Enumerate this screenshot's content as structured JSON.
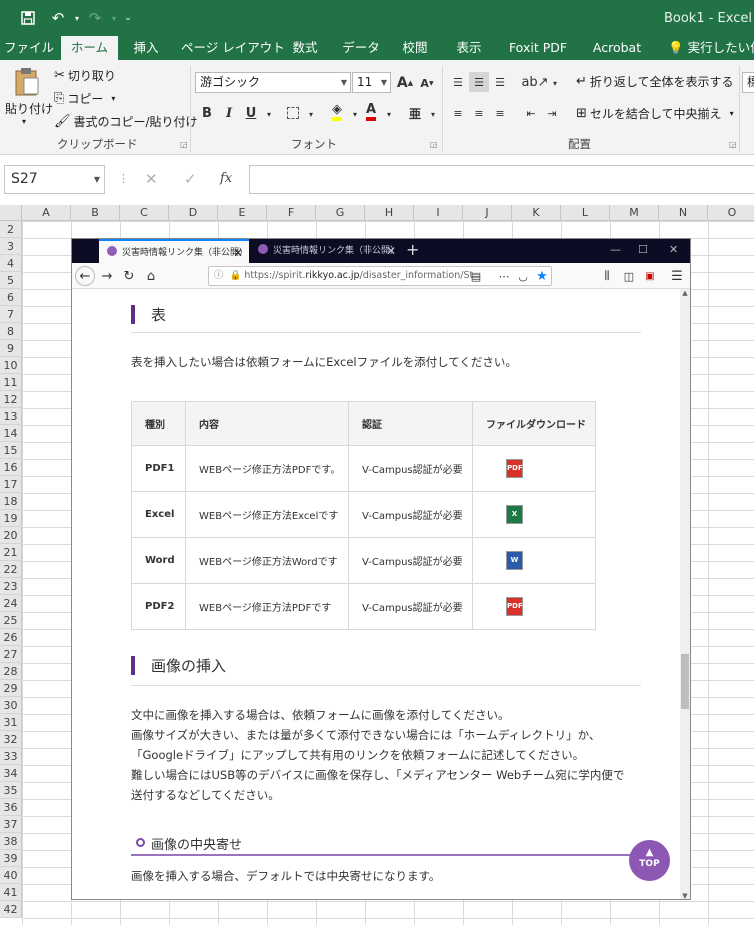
{
  "app": {
    "window_title": "Book1 - Excel",
    "qat": {
      "save_icon": "save-icon",
      "undo_icon": "undo-icon",
      "redo_icon": "redo-icon",
      "customize_icon": "chevron-down-icon"
    }
  },
  "ribbon_tabs": [
    {
      "label": "ファイル"
    },
    {
      "label": "ホーム"
    },
    {
      "label": "挿入"
    },
    {
      "label": "ページ レイアウト"
    },
    {
      "label": "数式"
    },
    {
      "label": "データ"
    },
    {
      "label": "校閲"
    },
    {
      "label": "表示"
    },
    {
      "label": "Foxit PDF"
    },
    {
      "label": "Acrobat"
    },
    {
      "label": "実行したい作業"
    }
  ],
  "clipboard": {
    "paste": "貼り付け",
    "cut": "切り取り",
    "copy": "コピー",
    "format_painter": "書式のコピー/貼り付け",
    "group_label": "クリップボード"
  },
  "font": {
    "name": "游ゴシック",
    "size": "11",
    "group_label": "フォント",
    "bold": "B",
    "italic": "I",
    "underline": "U",
    "font_color_glyph": "A",
    "grow_glyph": "A",
    "shrink_glyph": "A",
    "phonetic_glyph": "亜"
  },
  "alignment": {
    "wrap_text": "折り返して全体を表示する",
    "merge_center": "セルを結合して中央揃え",
    "group_label": "配置",
    "number_format_glyph": "標"
  },
  "formula_bar": {
    "name_box": "S27",
    "cancel_glyph": "✕",
    "enter_glyph": "✓",
    "fx_glyph": "fx",
    "value": ""
  },
  "sheet": {
    "columns": [
      "A",
      "B",
      "C",
      "D",
      "E",
      "F",
      "G",
      "H",
      "I",
      "J",
      "K",
      "L",
      "M",
      "N",
      "O"
    ],
    "rows": [
      "2",
      "3",
      "4",
      "5",
      "6",
      "7",
      "8",
      "9",
      "10",
      "11",
      "12",
      "13",
      "14",
      "15",
      "16",
      "17",
      "18",
      "19",
      "20",
      "21",
      "22",
      "23",
      "24",
      "25",
      "26",
      "27",
      "28",
      "29",
      "30",
      "31",
      "32",
      "33",
      "34",
      "35",
      "36",
      "37",
      "38",
      "39",
      "40",
      "41",
      "42"
    ]
  },
  "browser": {
    "tabs": [
      {
        "label": "災害時情報リンク集（非公開）"
      },
      {
        "label": "災害時情報リンク集（非公開）"
      }
    ],
    "url_prefix": "https://spirit.",
    "url_domain": "rikkyo.ac.jp",
    "url_path": "/disaster_information/St",
    "page": {
      "table_heading": "表",
      "table_intro": "表を挿入したい場合は依頼フォームにExcelファイルを添付してください。",
      "table": {
        "headers": [
          "種別",
          "内容",
          "認証",
          "ファイルダウンロード"
        ],
        "rows": [
          {
            "type": "PDF1",
            "content": "WEBページ修正方法PDFです。",
            "auth": "V-Campus認証が必要",
            "icon": "pdf-file-icon",
            "icon_label": "PDF",
            "icon_color": "#d9322b"
          },
          {
            "type": "Excel",
            "content": "WEBページ修正方法Excelです",
            "auth": "V-Campus認証が必要",
            "icon": "excel-file-icon",
            "icon_label": "X",
            "icon_color": "#1d7a46"
          },
          {
            "type": "Word",
            "content": "WEBページ修正方法Wordです",
            "auth": "V-Campus認証が必要",
            "icon": "word-file-icon",
            "icon_label": "W",
            "icon_color": "#2b5aa8"
          },
          {
            "type": "PDF2",
            "content": "WEBページ修正方法PDFです",
            "auth": "V-Campus認証が必要",
            "icon": "pdf-file-icon",
            "icon_label": "PDF",
            "icon_color": "#d9322b"
          }
        ]
      },
      "image_heading": "画像の挿入",
      "image_paragraph": [
        "文中に画像を挿入する場合は、依頼フォームに画像を添付してください。",
        "画像サイズが大きい、または量が多くて添付できない場合には「ホームディレクトリ」か、",
        "「Googleドライブ」にアップして共有用のリンクを依頼フォームに記述してください。",
        "難しい場合にはUSB等のデバイスに画像を保存し、「メディアセンター Webチーム宛に学内便で",
        "送付するなどしてください。"
      ],
      "center_heading": "画像の中央寄せ",
      "center_text": "画像を挿入する場合、デフォルトでは中央寄せになります。",
      "top_button": "TOP"
    }
  },
  "colors": {
    "excel_green": "#217346",
    "brand_purple": "#5d2f86",
    "top_button": "#8c58b4"
  }
}
